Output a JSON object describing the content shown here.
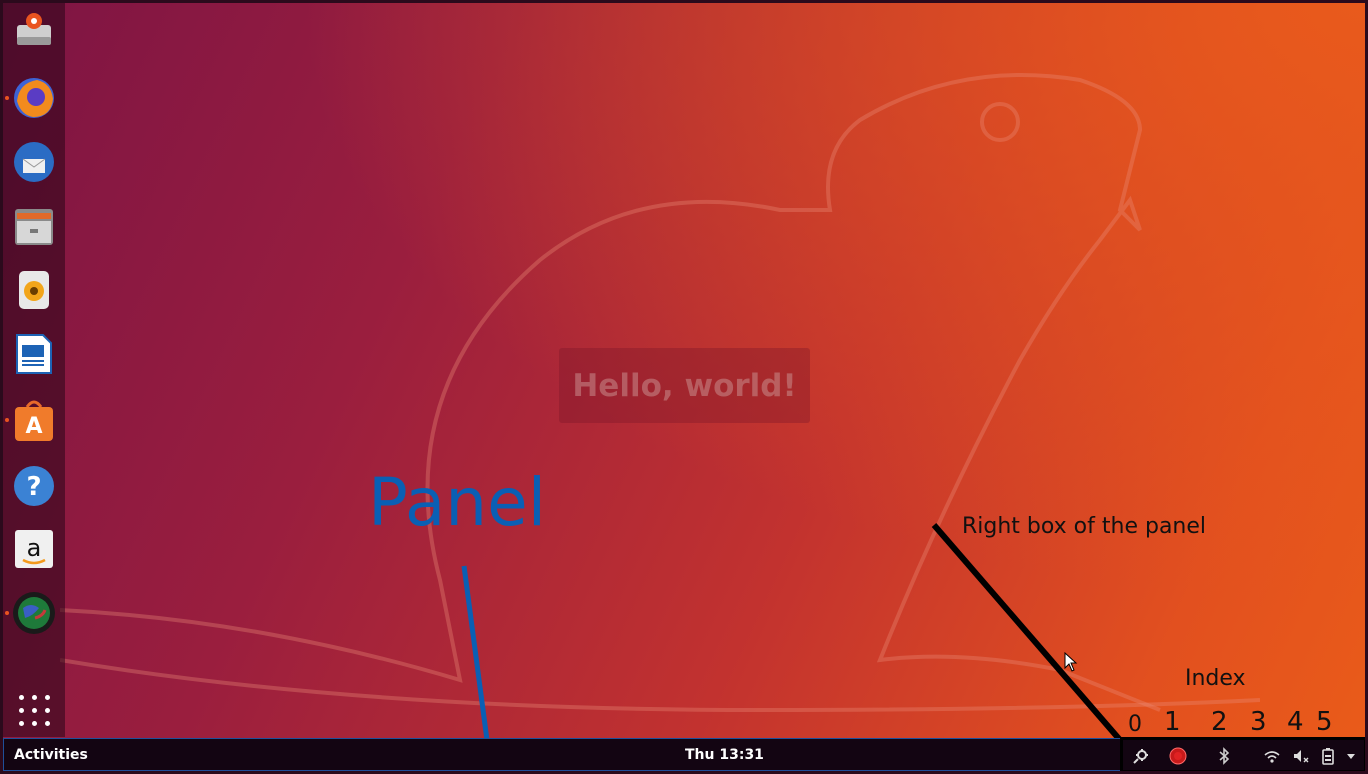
{
  "annotations": {
    "panel_label": "Panel",
    "right_box_label": "Right box of the panel",
    "index_label": "Index",
    "indices": [
      "0",
      "1",
      "2",
      "3",
      "4",
      "5"
    ]
  },
  "desktop": {
    "hello_text": "Hello, world!"
  },
  "panel": {
    "activities_label": "Activities",
    "clock": "Thu 13:31"
  },
  "dock": {
    "items": [
      {
        "icon": "files-drive-icon",
        "running": false
      },
      {
        "icon": "firefox-icon",
        "running": true
      },
      {
        "icon": "thunderbird-icon",
        "running": false
      },
      {
        "icon": "file-manager-icon",
        "running": false
      },
      {
        "icon": "rhythmbox-icon",
        "running": false
      },
      {
        "icon": "libreoffice-writer-icon",
        "running": false
      },
      {
        "icon": "ubuntu-software-icon",
        "running": true
      },
      {
        "icon": "help-icon",
        "running": false
      },
      {
        "icon": "amazon-icon",
        "running": false
      },
      {
        "icon": "globe-app-icon",
        "running": true
      }
    ],
    "show_apps_icon": "show-applications-icon"
  },
  "tray": {
    "items": [
      "extension-gear-icon",
      "record-icon",
      "bluetooth-icon",
      "wifi-icon",
      "volume-muted-icon",
      "battery-icon",
      "menu-arrow-icon"
    ]
  },
  "colors": {
    "accent": "#e95420",
    "annotation_blue": "#0a5fb4",
    "panel_bg": "#130512",
    "panel_border": "#1f4f9a"
  }
}
